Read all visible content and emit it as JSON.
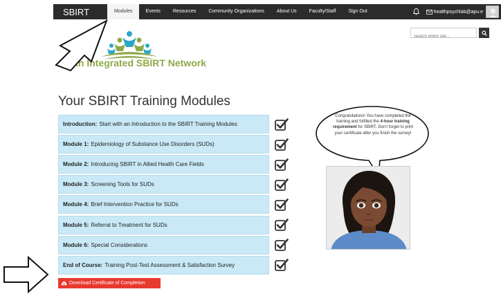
{
  "navbar": {
    "brand": "SBIRT",
    "items": [
      "Modules",
      "Events",
      "Resources",
      "Community Organizations",
      "About Us",
      "Faculty/Staff",
      "Sign Out"
    ],
    "active_item": "Modules",
    "email": "healthpsychlab@apu.e"
  },
  "search": {
    "placeholder": "Search entire site..."
  },
  "logo": {
    "text": "Faith Integrated SBIRT Network"
  },
  "main": {
    "title": "Your SBIRT Training Modules",
    "modules": [
      {
        "name": "Introduction:",
        "description": "Start with an Introduction to the SBIRT Training Modules",
        "completed": true
      },
      {
        "name": "Module 1:",
        "description": "Epidemiology of Substance Use Disorders (SUDs)",
        "completed": true
      },
      {
        "name": "Module 2:",
        "description": "Introducing SBIRT in Allied Health Care Fields",
        "completed": true
      },
      {
        "name": "Module 3:",
        "description": "Screening Tools for SUDs",
        "completed": true
      },
      {
        "name": "Module 4:",
        "description": "Brief Intervention Practice for SUDs",
        "completed": true
      },
      {
        "name": "Module 5:",
        "description": "Referral to Treatment for SUDs",
        "completed": true
      },
      {
        "name": "Module 6:",
        "description": "Special Considerations",
        "completed": true
      },
      {
        "name": "End of Course:",
        "description": "Training Post-Test Assessment & Satisfaction Survey",
        "completed": true
      }
    ],
    "download_label": "Download Certificate of Completion"
  },
  "bubble": {
    "text_before": "Congratulations! You have completed the training and fulfilled the ",
    "text_bold": "4-hour training requirement",
    "text_after": " for SBIRT. Don't forget to print your certificate after you finish the survey!"
  },
  "colors": {
    "navbar_bg": "#2b2b2b",
    "module_bg": "#c9e9f7",
    "logo_green": "#8fa84a",
    "download_red": "#e8392f"
  }
}
